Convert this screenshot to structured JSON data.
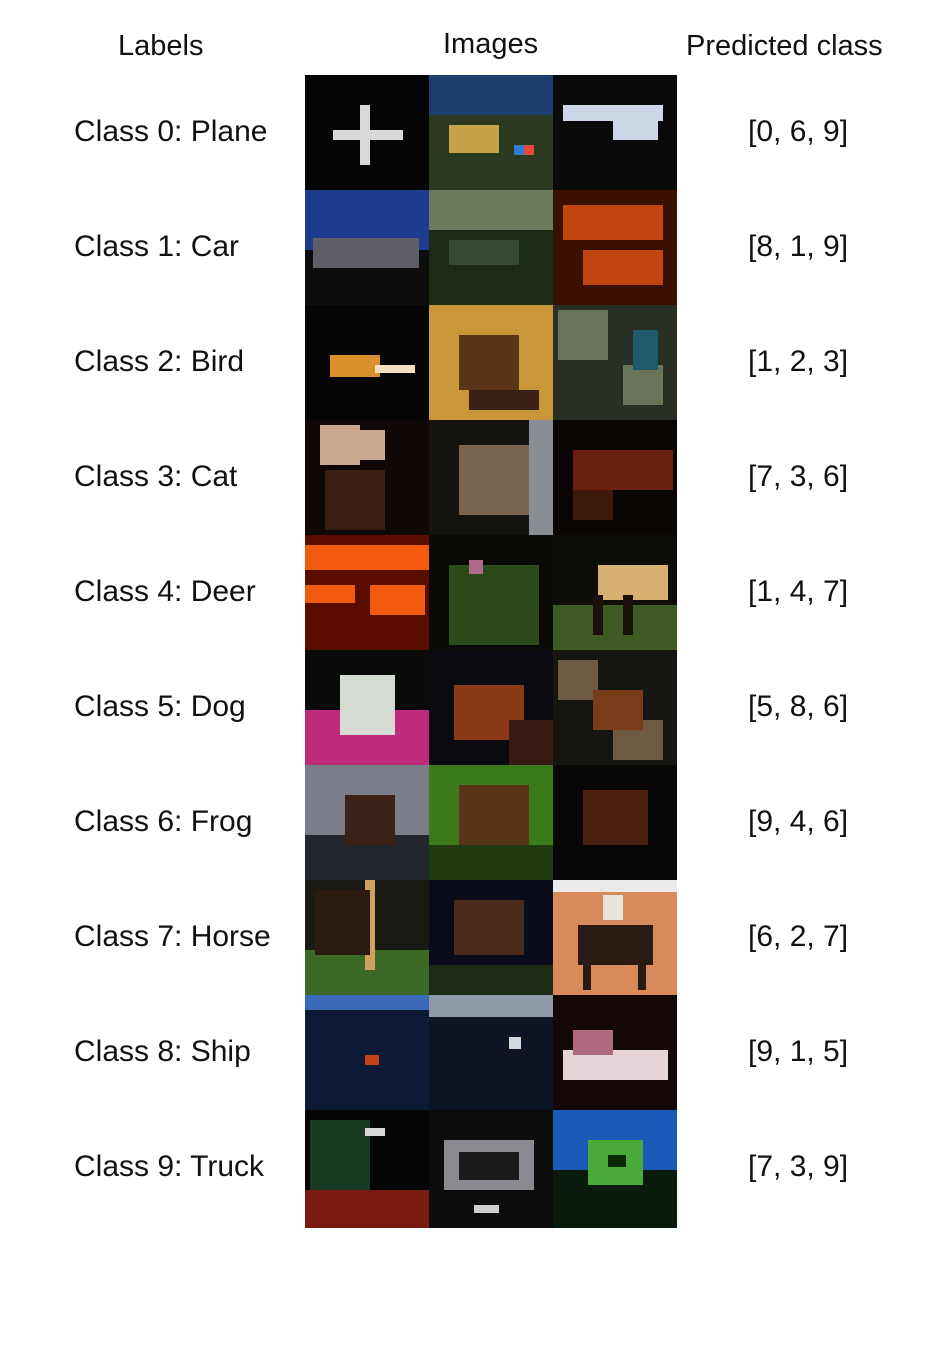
{
  "headers": {
    "labels": "Labels",
    "images": "Images",
    "predicted": "Predicted class"
  },
  "rows": [
    {
      "label": "Class 0: Plane",
      "pred": "[0, 6, 9]",
      "images": [
        "plane-on-dark",
        "landscape-with-flag",
        "airliner"
      ]
    },
    {
      "label": "Class 1: Car",
      "pred": "[8, 1, 9]",
      "images": [
        "car-on-blue-sky",
        "forest-road",
        "red-orange-car"
      ]
    },
    {
      "label": "Class 2: Bird",
      "pred": "[1, 2, 3]",
      "images": [
        "bird-on-dark",
        "brown-bird-yellow-bg",
        "bird-in-foliage"
      ]
    },
    {
      "label": "Class 3: Cat",
      "pred": "[7, 3, 6]",
      "images": [
        "cat-dark",
        "tabby-cat",
        "brown-cat"
      ]
    },
    {
      "label": "Class 4: Deer",
      "pred": "[1, 4, 7]",
      "images": [
        "red-orange-scene",
        "deer-in-grass",
        "pale-deer-on-grass"
      ]
    },
    {
      "label": "Class 5: Dog",
      "pred": "[5, 8, 6]",
      "images": [
        "white-dog-pink-bg",
        "brown-dog",
        "dog-in-foliage"
      ]
    },
    {
      "label": "Class 6: Frog",
      "pred": "[9, 4, 6]",
      "images": [
        "frog-grey-bg",
        "frog-green-leaves",
        "dark-frog"
      ]
    },
    {
      "label": "Class 7: Horse",
      "pred": "[6, 2, 7]",
      "images": [
        "horse-head-grass",
        "horse-dark",
        "rider-on-horse"
      ]
    },
    {
      "label": "Class 8: Ship",
      "pred": "[9, 1, 5]",
      "images": [
        "city-harbor",
        "dark-water",
        "pink-white-boat"
      ]
    },
    {
      "label": "Class 9: Truck",
      "pred": "[7, 3, 9]",
      "images": [
        "dark-truck",
        "truck-front",
        "green-truck-blue-sky"
      ]
    }
  ]
}
